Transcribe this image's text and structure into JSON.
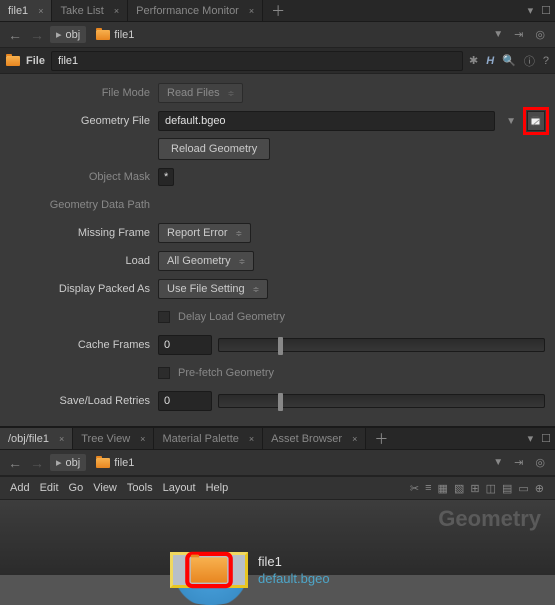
{
  "tabs_top": [
    {
      "label": "file1",
      "active": true
    },
    {
      "label": "Take List",
      "active": false
    },
    {
      "label": "Performance Monitor",
      "active": false
    }
  ],
  "nav": {
    "path_obj": "obj",
    "path_node": "file1"
  },
  "title": {
    "type_label": "File",
    "name": "file1"
  },
  "icons": {
    "gear": "gear-icon",
    "cog": "cog-icon",
    "link": "link-icon",
    "search": "search-icon",
    "info": "info-icon",
    "help": "help-icon",
    "H": "H"
  },
  "params": {
    "file_mode": {
      "label": "File Mode",
      "value": "Read Files"
    },
    "geometry_file": {
      "label": "Geometry File",
      "value": "default.bgeo"
    },
    "reload_btn": "Reload Geometry",
    "object_mask": {
      "label": "Object Mask",
      "value": "*"
    },
    "geom_data_path": {
      "label": "Geometry Data Path",
      "value": ""
    },
    "missing_frame": {
      "label": "Missing Frame",
      "value": "Report Error"
    },
    "load": {
      "label": "Load",
      "value": "All Geometry"
    },
    "display_packed": {
      "label": "Display Packed As",
      "value": "Use File Setting"
    },
    "delay_load": {
      "label": "Delay Load Geometry",
      "checked": false
    },
    "cache_frames": {
      "label": "Cache Frames",
      "value": "0"
    },
    "prefetch": {
      "label": "Pre-fetch Geometry",
      "checked": false
    },
    "save_retries": {
      "label": "Save/Load Retries",
      "value": "0"
    }
  },
  "tabs_bottom": [
    {
      "label": "/obj/file1",
      "active": true
    },
    {
      "label": "Tree View",
      "active": false
    },
    {
      "label": "Material Palette",
      "active": false
    },
    {
      "label": "Asset Browser",
      "active": false
    }
  ],
  "menubar": [
    "Add",
    "Edit",
    "Go",
    "View",
    "Tools",
    "Layout",
    "Help"
  ],
  "network": {
    "title": "Geometry",
    "node_name": "file1",
    "node_file": "default.bgeo"
  },
  "colors": {
    "highlight": "#ff0000",
    "accent": "#4da6c9",
    "folder": "#e88620"
  }
}
